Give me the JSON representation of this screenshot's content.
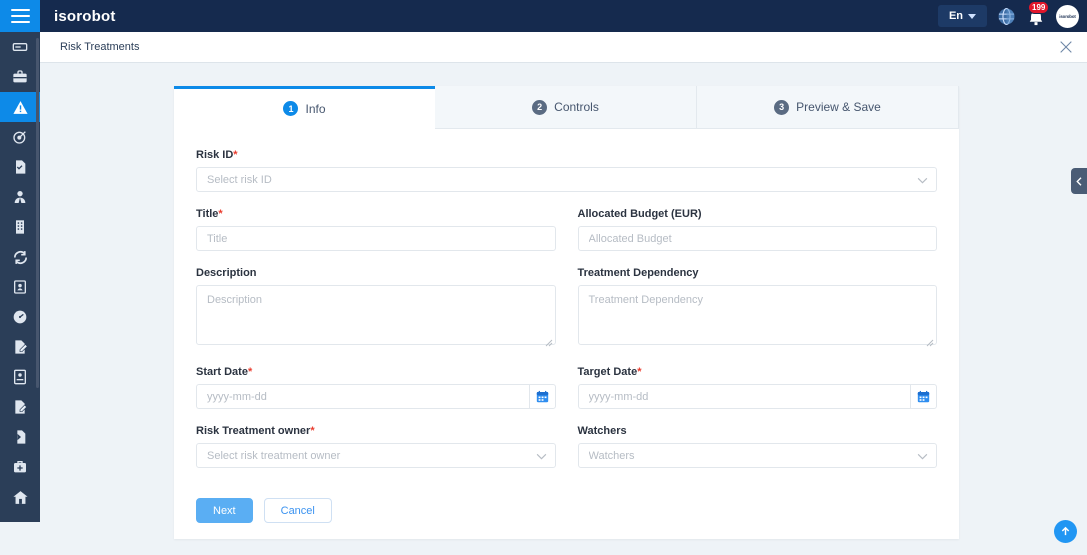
{
  "topbar": {
    "brand": "isorobot",
    "language": "En",
    "notification_count": "199",
    "avatar_text": "isorobot",
    "globe_icon": "globe-icon",
    "bell_icon": "bell-icon",
    "hamburger_icon": "hamburger-icon",
    "accent_blue": "#0d8ae8",
    "bar_bg": "#152a4e"
  },
  "breadcrumb": {
    "title": "Risk Treatments",
    "close_icon": "close-icon"
  },
  "sidebar": {
    "active_index": 2,
    "items": [
      {
        "icon": "card-icon",
        "label": "Cards"
      },
      {
        "icon": "briefcase-icon",
        "label": "Business"
      },
      {
        "icon": "warning-triangle-icon",
        "label": "Risk"
      },
      {
        "icon": "target-icon",
        "label": "Objectives"
      },
      {
        "icon": "document-check-icon",
        "label": "Documents"
      },
      {
        "icon": "user-tie-icon",
        "label": "Personnel"
      },
      {
        "icon": "building-icon",
        "label": "Organization"
      },
      {
        "icon": "refresh-icon",
        "label": "Processes"
      },
      {
        "icon": "id-card-icon",
        "label": "Records"
      },
      {
        "icon": "speedometer-icon",
        "label": "Performance"
      },
      {
        "icon": "document-edit-icon",
        "label": "Audits"
      },
      {
        "icon": "badge-icon",
        "label": "Compliance"
      },
      {
        "icon": "form-edit-icon",
        "label": "Forms"
      },
      {
        "icon": "export-icon",
        "label": "Export"
      },
      {
        "icon": "first-aid-icon",
        "label": "Health & Safety"
      },
      {
        "icon": "home-icon",
        "label": "Home"
      }
    ]
  },
  "tabs": [
    {
      "number": "1",
      "label": "Info",
      "active": true
    },
    {
      "number": "2",
      "label": "Controls",
      "active": false
    },
    {
      "number": "3",
      "label": "Preview & Save",
      "active": false
    }
  ],
  "form": {
    "risk_id": {
      "label": "Risk ID",
      "required": true,
      "placeholder": "Select risk ID",
      "value": "",
      "type": "select"
    },
    "title": {
      "label": "Title",
      "required": true,
      "placeholder": "Title",
      "value": "",
      "type": "text"
    },
    "allocated_budget": {
      "label": "Allocated Budget (EUR)",
      "required": false,
      "placeholder": "Allocated Budget",
      "value": "",
      "type": "text"
    },
    "description": {
      "label": "Description",
      "required": false,
      "placeholder": "Description",
      "value": "",
      "type": "textarea"
    },
    "treatment_dependency": {
      "label": "Treatment Dependency",
      "required": false,
      "placeholder": "Treatment Dependency",
      "value": "",
      "type": "textarea"
    },
    "start_date": {
      "label": "Start Date",
      "required": true,
      "placeholder": "yyyy-mm-dd",
      "value": "",
      "type": "date",
      "icon": "calendar-icon"
    },
    "target_date": {
      "label": "Target Date",
      "required": true,
      "placeholder": "yyyy-mm-dd",
      "value": "",
      "type": "date",
      "icon": "calendar-icon"
    },
    "risk_treatment_owner": {
      "label": "Risk Treatment owner",
      "required": true,
      "placeholder": "Select risk treatment owner",
      "value": "",
      "type": "select"
    },
    "watchers": {
      "label": "Watchers",
      "required": false,
      "placeholder": "Watchers",
      "value": "",
      "type": "select"
    },
    "required_marker": "*"
  },
  "actions": {
    "next_label": "Next",
    "cancel_label": "Cancel",
    "primary_color": "#5aaef3",
    "outline_color": "#3b93f0"
  },
  "widgets": {
    "side_handle_icon": "arrow-left-icon",
    "scroll_top_icon": "arrow-up-icon"
  }
}
